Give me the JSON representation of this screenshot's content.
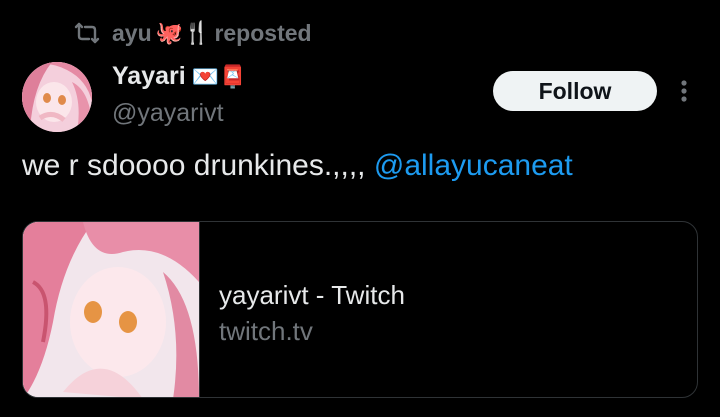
{
  "repost": {
    "user": "ayu",
    "emojis": "🐙🍴",
    "label": "reposted"
  },
  "author": {
    "name": "Yayari",
    "name_emojis": "💌📮",
    "handle": "@yayarivt"
  },
  "follow_label": "Follow",
  "tweet": {
    "text": "we r sdoooo drunkines.,,,, ",
    "mention": "@allayucaneat"
  },
  "card": {
    "title": "yayarivt - Twitch",
    "domain": "twitch.tv"
  },
  "colors": {
    "background": "#000000",
    "text": "#e7e9ea",
    "muted": "#71767b",
    "link": "#1d9bf0",
    "border": "#2f3336"
  },
  "icons": {
    "repost": "repost-icon",
    "more": "more-options-icon"
  }
}
